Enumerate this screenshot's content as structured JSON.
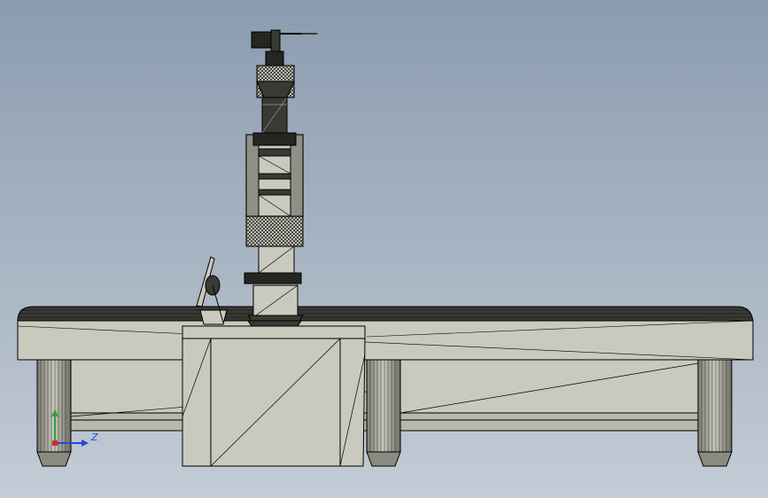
{
  "colors": {
    "background_top": "#8b9cb0",
    "background_bottom": "#c3ccd6",
    "model_fill": "#c9c9bd",
    "model_dark": "#3a3a34",
    "edge": "#000000",
    "axis_x": "#d0302a",
    "axis_y": "#2ea043",
    "axis_z": "#2747d8"
  },
  "triad": {
    "z_label": "Z"
  }
}
